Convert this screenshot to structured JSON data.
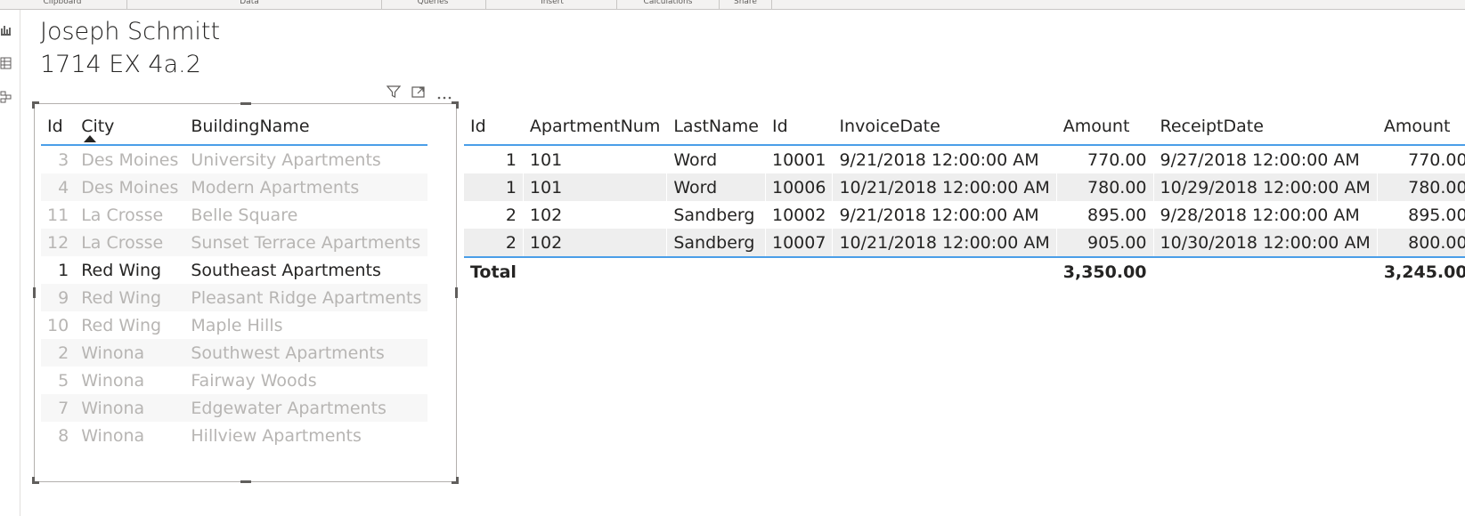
{
  "ribbon": {
    "groups": [
      "Clipboard",
      "Data",
      "Queries",
      "Insert",
      "Calculations",
      "Share"
    ]
  },
  "leftbar": {
    "icons": [
      "report-view-icon",
      "data-view-icon",
      "model-view-icon"
    ]
  },
  "page": {
    "title_line1": "Joseph Schmitt",
    "title_line2": "1714 EX 4a.2"
  },
  "left_visual": {
    "header_icons": [
      "filter-icon",
      "focus-mode-icon",
      "more-options-icon"
    ],
    "columns": [
      "Id",
      "City",
      "BuildingName"
    ],
    "rows": [
      {
        "id": "3",
        "city": "Des Moines",
        "building": "University Apartments"
      },
      {
        "id": "4",
        "city": "Des Moines",
        "building": "Modern Apartments"
      },
      {
        "id": "11",
        "city": "La Crosse",
        "building": "Belle Square"
      },
      {
        "id": "12",
        "city": "La Crosse",
        "building": "Sunset Terrace Apartments"
      },
      {
        "id": "1",
        "city": "Red Wing",
        "building": "Southeast Apartments"
      },
      {
        "id": "9",
        "city": "Red Wing",
        "building": "Pleasant Ridge Apartments"
      },
      {
        "id": "10",
        "city": "Red Wing",
        "building": "Maple Hills"
      },
      {
        "id": "2",
        "city": "Winona",
        "building": "Southwest Apartments"
      },
      {
        "id": "5",
        "city": "Winona",
        "building": "Fairway Woods"
      },
      {
        "id": "7",
        "city": "Winona",
        "building": "Edgewater Apartments"
      },
      {
        "id": "8",
        "city": "Winona",
        "building": "Hillview Apartments"
      }
    ]
  },
  "right_visual": {
    "columns": [
      "Id",
      "ApartmentNum",
      "LastName",
      "Id",
      "InvoiceDate",
      "Amount",
      "ReceiptDate",
      "Amount"
    ],
    "rows": [
      [
        "1",
        "101",
        "Word",
        "10001",
        "9/21/2018 12:00:00 AM",
        "770.00",
        "9/27/2018 12:00:00 AM",
        "770.00"
      ],
      [
        "1",
        "101",
        "Word",
        "10006",
        "10/21/2018 12:00:00 AM",
        "780.00",
        "10/29/2018 12:00:00 AM",
        "780.00"
      ],
      [
        "2",
        "102",
        "Sandberg",
        "10002",
        "9/21/2018 12:00:00 AM",
        "895.00",
        "9/28/2018 12:00:00 AM",
        "895.00"
      ],
      [
        "2",
        "102",
        "Sandberg",
        "10007",
        "10/21/2018 12:00:00 AM",
        "905.00",
        "10/30/2018 12:00:00 AM",
        "800.00"
      ]
    ],
    "total": {
      "label": "Total",
      "invoice_amount": "3,350.00",
      "receipt_amount": "3,245.00"
    }
  }
}
